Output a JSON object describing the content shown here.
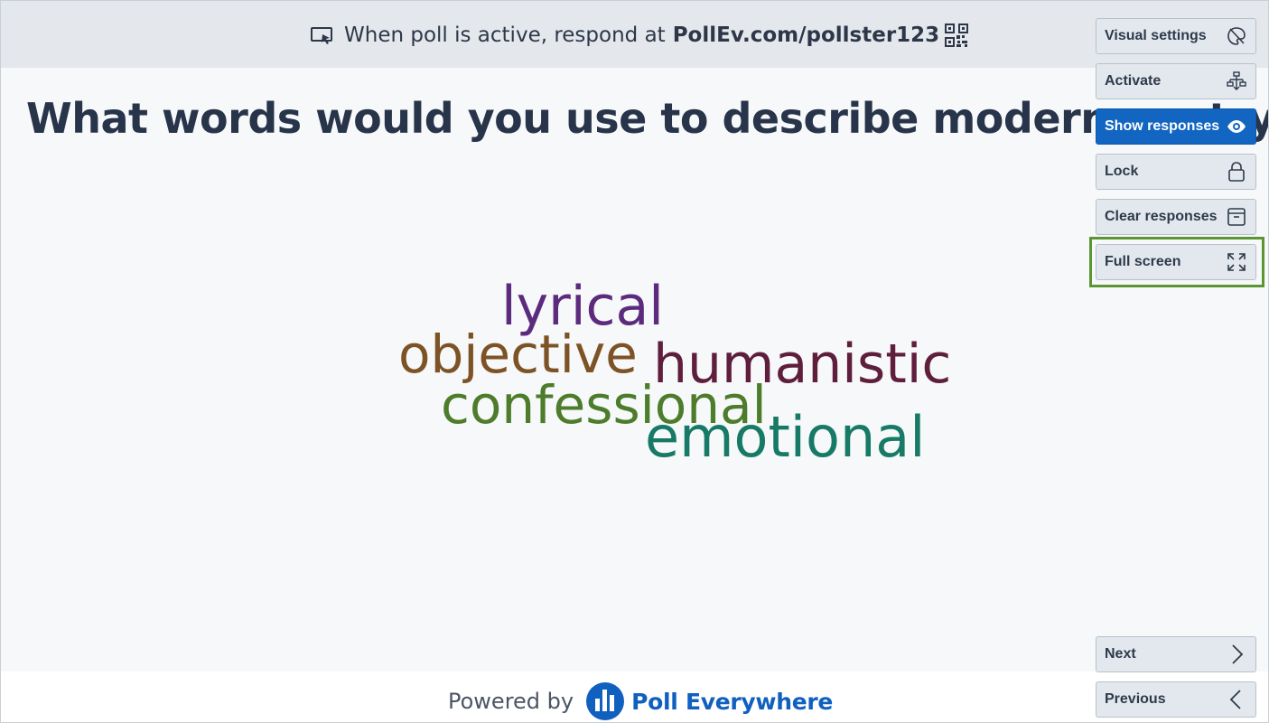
{
  "banner": {
    "respond_text": "When poll is active, respond at",
    "respond_url": "PollEv.com/pollster123",
    "screen_icon": "screen-icon",
    "qr_icon": "qr-code-icon"
  },
  "question": {
    "title": "What words would you use to describe modern poetry?"
  },
  "word_cloud": {
    "words": [
      {
        "text": "lyrical",
        "color": "#5c2b7d"
      },
      {
        "text": "objective",
        "color": "#7d5326"
      },
      {
        "text": "humanistic",
        "color": "#5e1e3c"
      },
      {
        "text": "confessional",
        "color": "#4d7c2b"
      },
      {
        "text": "emotional",
        "color": "#177a66"
      }
    ]
  },
  "controls": {
    "visual_settings": "Visual settings",
    "activate": "Activate",
    "show_responses": "Show responses",
    "lock": "Lock",
    "clear_responses": "Clear responses",
    "full_screen": "Full screen",
    "next": "Next",
    "previous": "Previous",
    "highlighted": "Full screen",
    "accent_color": "#1266c2",
    "highlight_color": "#5b9632"
  },
  "footer": {
    "powered_by": "Powered by",
    "brand": "Poll Everywhere",
    "brand_color": "#1060c0"
  }
}
